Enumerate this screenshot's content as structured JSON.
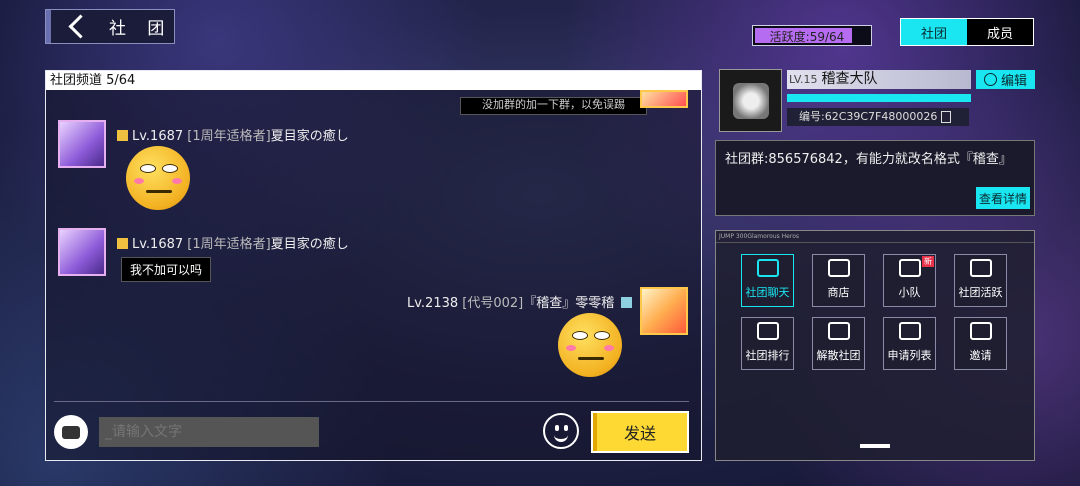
{
  "header": {
    "back_label": "社 团",
    "activity_label": "活跃度:59/64",
    "activity_fraction": 0.921,
    "tabs": [
      {
        "label": "社团",
        "active": true
      },
      {
        "label": "成员",
        "active": false
      }
    ]
  },
  "chat": {
    "title": "社团频道  5/64",
    "top_partial_text": "没加群的加一下群，以免误踢",
    "messages": [
      {
        "level": "Lv.1687",
        "tag": "[1周年适格者]",
        "name": "夏目家の癒し",
        "content": "smiley-sticker"
      },
      {
        "level": "Lv.1687",
        "tag": "[1周年适格者]",
        "name": "夏目家の癒し",
        "text": "我不加可以吗"
      },
      {
        "level": "Lv.2138",
        "tag": "[代号002]",
        "name": "『稽查』零零稽",
        "content": "smiley-sticker"
      }
    ],
    "input_placeholder": "_请输入文字",
    "send_label": "发送"
  },
  "club": {
    "level": "LV.15",
    "name": "稽查大队",
    "edit_label": "编辑",
    "id_text": "编号:62C39C7F48000026",
    "notice": "社团群:856576842，有能力就改名格式『稽查』",
    "detail_label": "查看详情"
  },
  "menu": {
    "caption": "JUMP 300Glamorous Heros",
    "items": [
      {
        "label": "社团聊天",
        "icon": "chat-icon",
        "selected": true
      },
      {
        "label": "商店",
        "icon": "cart-icon"
      },
      {
        "label": "小队",
        "icon": "flag-icon",
        "badge": "新"
      },
      {
        "label": "社团活跃",
        "icon": "handshake-icon"
      },
      {
        "label": "社团排行",
        "icon": "crown-icon"
      },
      {
        "label": "解散社团",
        "icon": "ban-icon"
      },
      {
        "label": "申请列表",
        "icon": "document-icon"
      },
      {
        "label": "邀请",
        "icon": "invite-icon"
      }
    ]
  },
  "colors": {
    "accent": "#19e6f0",
    "send": "#ffd933",
    "activity": "#b56cf0"
  }
}
